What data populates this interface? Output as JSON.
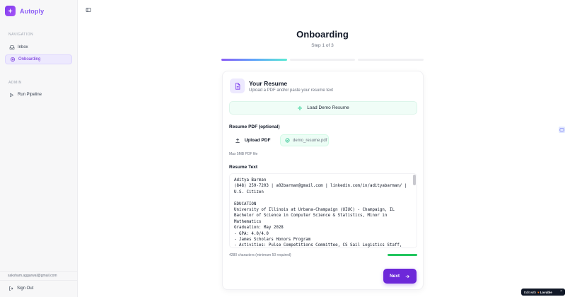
{
  "app": {
    "name": "Autoply"
  },
  "sidebar": {
    "sections": [
      {
        "title": "NAVIGATION"
      },
      {
        "title": "ADMIN"
      }
    ],
    "items": [
      {
        "label": "Inbox",
        "icon": "inbox-icon",
        "active": false
      },
      {
        "label": "Onboarding",
        "icon": "gear-icon",
        "active": true
      },
      {
        "label": "Run Pipeline",
        "icon": "play-icon",
        "active": false
      }
    ],
    "user_email": "saksham.aggarwal@gmail.com",
    "sign_out": "Sign Out"
  },
  "main": {
    "title": "Onboarding",
    "step": "Step 1 of 3",
    "progress": {
      "current": 1,
      "total": 3
    }
  },
  "card": {
    "title": "Your Resume",
    "description": "Upload a PDF and/or paste your resume text",
    "demo_button": "Load Demo Resume",
    "pdf_label": "Resume PDF (optional)",
    "upload_button": "Upload PDF",
    "file_name": "demo_resume.pdf",
    "max_hint": "Max 5MB PDF file",
    "text_label": "Resume Text",
    "resume_text": "Aditya Barman\n(848) 259-7203 | a02barman@gmail.com | linkedin.com/in/adityabarman/ | U.S. Citizen\n\nEDUCATION\nUniversity of Illinois at Urbana-Champaign (UIUC) - Champaign, IL\nBachelor of Science in Computer Science & Statistics, Minor in Mathematics\nGraduation: May 2028\n- GPA: 4.0/4.0\n- James Scholars Honors Program\n- Activities: Pulse Competitions Committee, CS Sail Logistics Staff, Simplify Campus Ambassador",
    "char_count": "4280 characters (minimum 50 required)",
    "char_progress": 1.0,
    "next_button": "Next"
  },
  "badge": {
    "prefix": "Edit with",
    "brand": "Lovable",
    "close": "×"
  },
  "colors": {
    "accent": "#6d28d9",
    "brand": "#8b5cf6",
    "success": "#22c55e"
  }
}
